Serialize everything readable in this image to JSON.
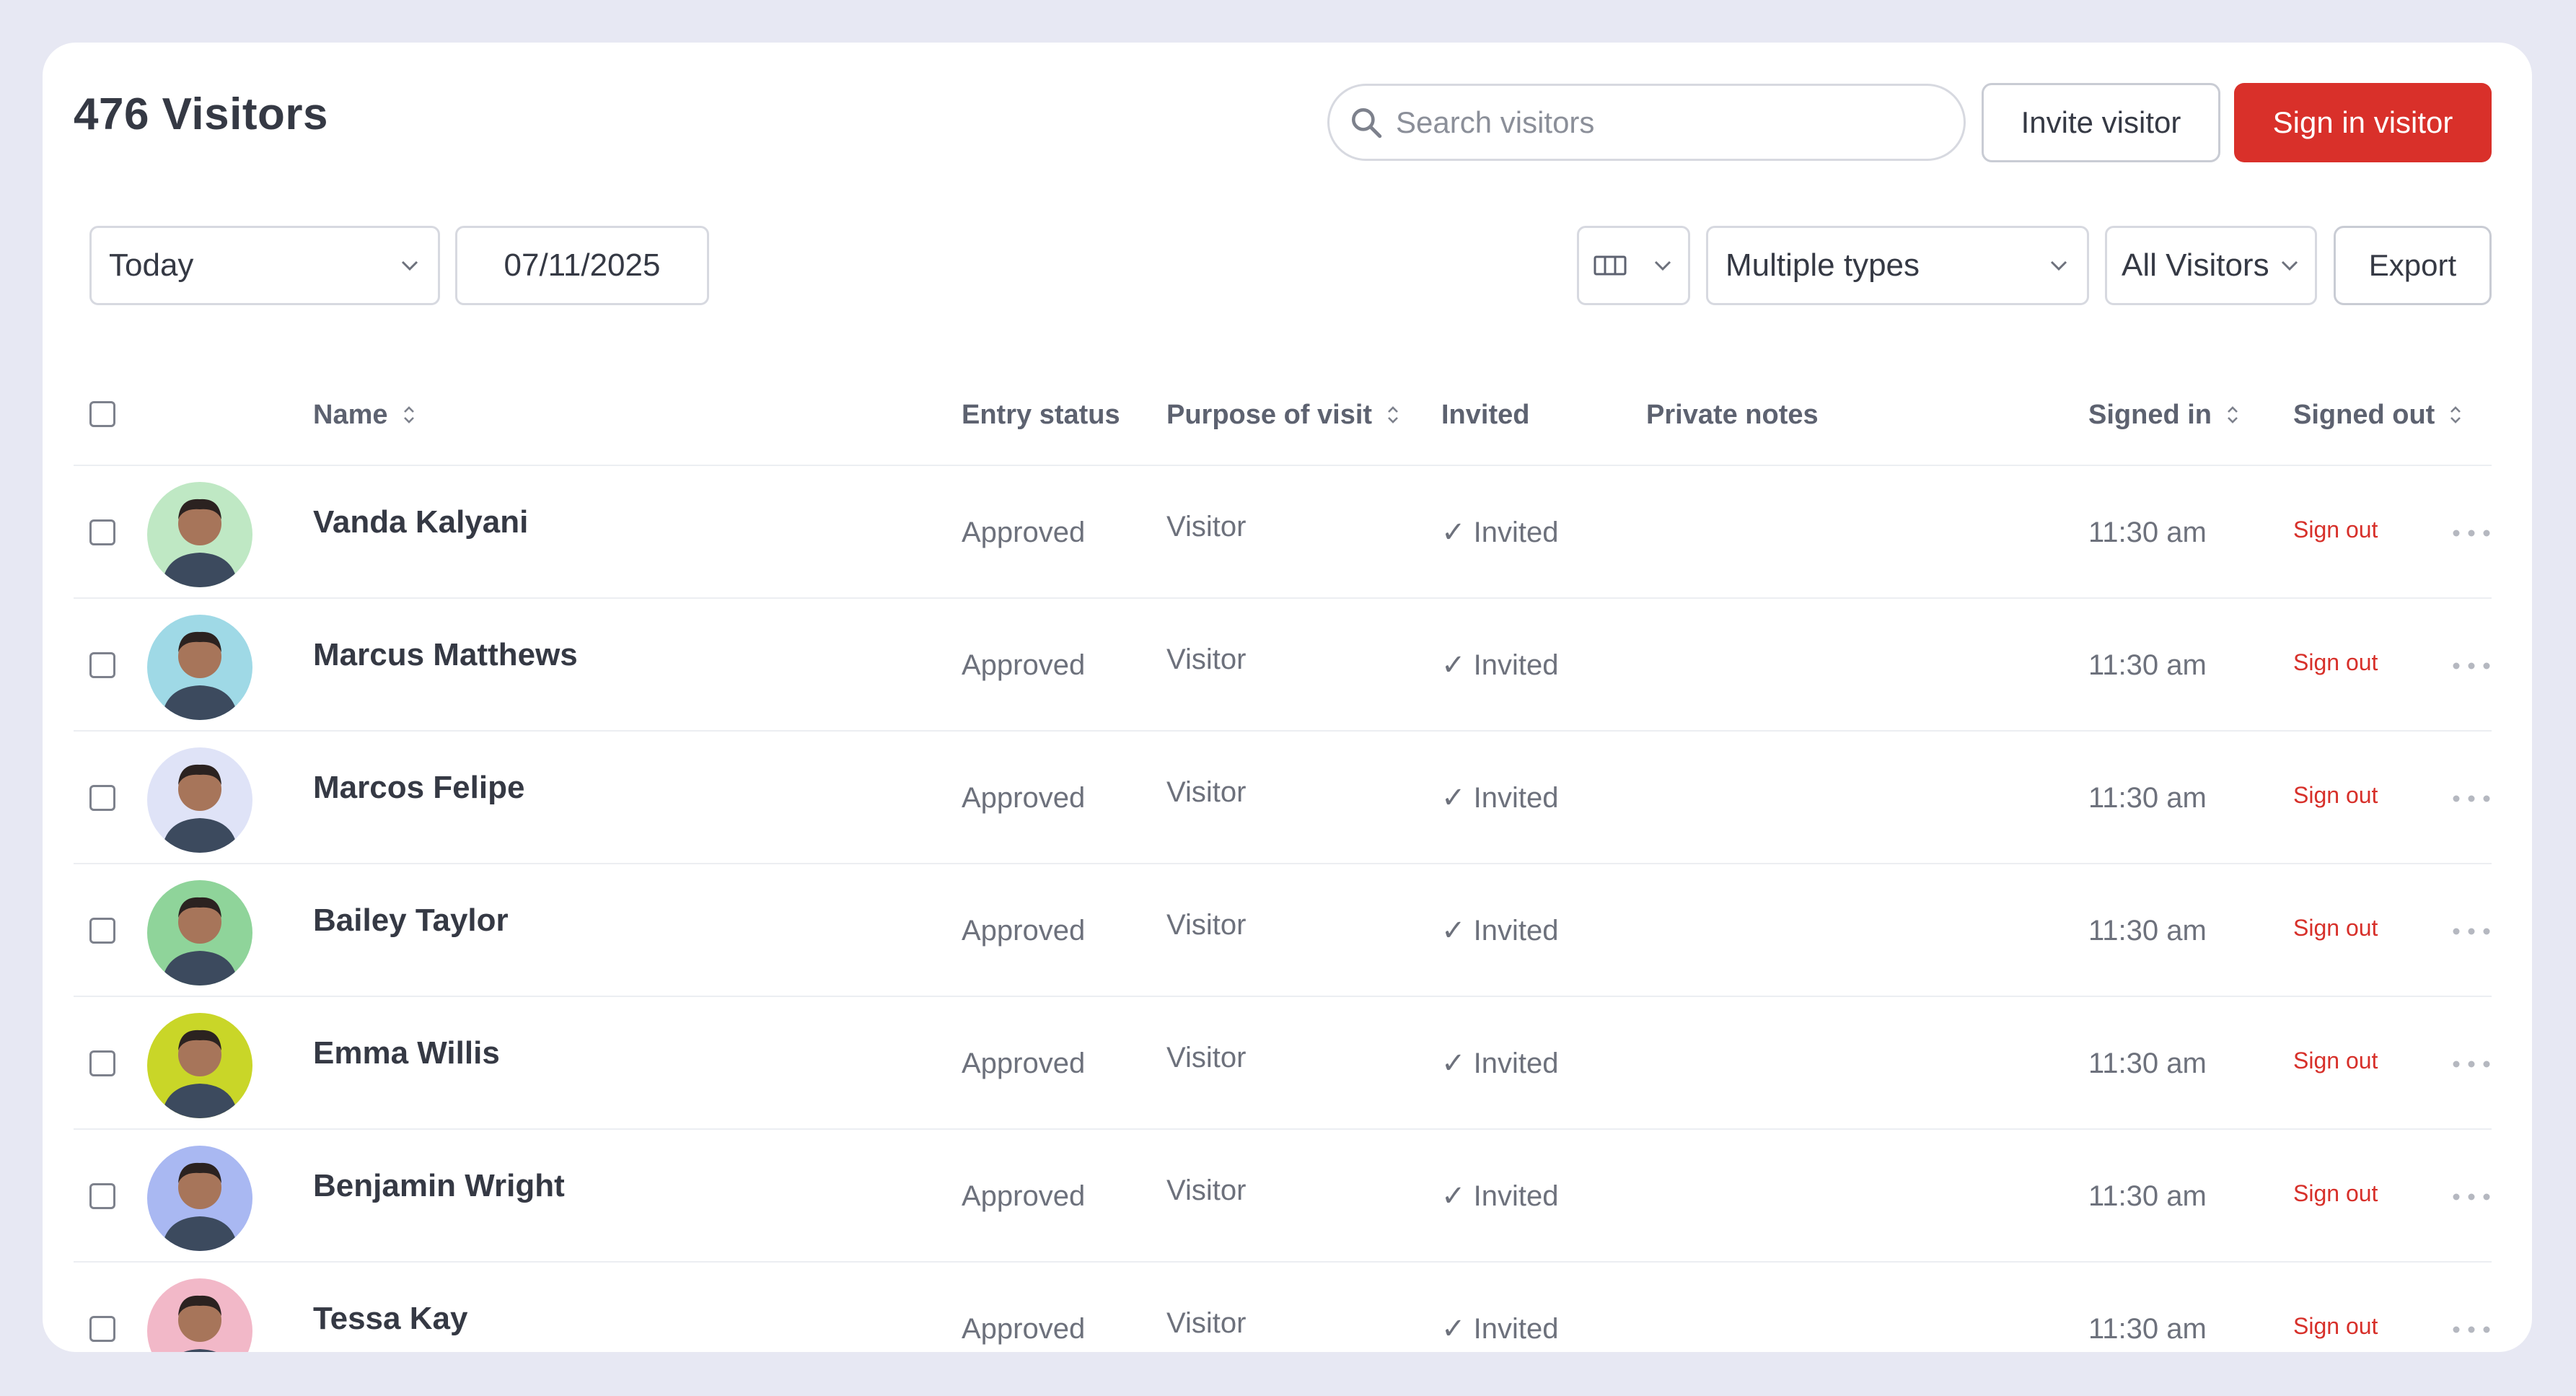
{
  "header": {
    "title": "476 Visitors",
    "search_placeholder": "Search visitors",
    "invite_label": "Invite visitor",
    "sign_in_label": "Sign in visitor"
  },
  "filters": {
    "period": "Today",
    "date": "07/11/2025",
    "type": "Multiple types",
    "audience": "All Visitors",
    "export_label": "Export"
  },
  "columns": {
    "name": "Name",
    "entry_status": "Entry status",
    "purpose": "Purpose of visit",
    "invited": "Invited",
    "notes": "Private notes",
    "signed_in": "Signed in",
    "signed_out": "Signed out"
  },
  "rows": [
    {
      "name": "Vanda Kalyani",
      "status": "Approved",
      "purpose": "Visitor",
      "invited": "✓ Invited",
      "signed_in": "11:30 am",
      "action": "Sign out"
    },
    {
      "name": "Marcus Matthews",
      "status": "Approved",
      "purpose": "Visitor",
      "invited": "✓ Invited",
      "signed_in": "11:30 am",
      "action": "Sign out"
    },
    {
      "name": "Marcos Felipe",
      "status": "Approved",
      "purpose": "Visitor",
      "invited": "✓ Invited",
      "signed_in": "11:30 am",
      "action": "Sign out"
    },
    {
      "name": "Bailey Taylor",
      "status": "Approved",
      "purpose": "Visitor",
      "invited": "✓ Invited",
      "signed_in": "11:30 am",
      "action": "Sign out"
    },
    {
      "name": "Emma Willis",
      "status": "Approved",
      "purpose": "Visitor",
      "invited": "✓ Invited",
      "signed_in": "11:30 am",
      "action": "Sign out"
    },
    {
      "name": "Benjamin Wright",
      "status": "Approved",
      "purpose": "Visitor",
      "invited": "✓ Invited",
      "signed_in": "11:30 am",
      "action": "Sign out"
    },
    {
      "name": "Tessa Kay",
      "status": "Approved",
      "purpose": "Visitor",
      "invited": "✓ Invited",
      "signed_in": "11:30 am",
      "action": "Sign out"
    }
  ],
  "avatar_colors": [
    "#bfe8c4",
    "#9fd9e6",
    "#dfe3f7",
    "#8fd49a",
    "#c9d628",
    "#a9b8f2",
    "#f2b8c8"
  ],
  "accent_color": "#d9302a"
}
